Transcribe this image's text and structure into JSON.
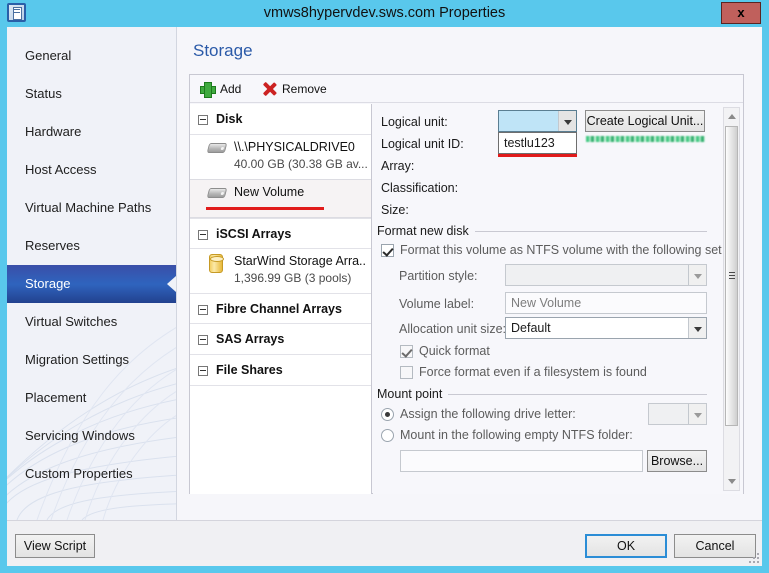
{
  "window": {
    "title": "vmws8hypervdev.sws.com Properties",
    "icon": "host-server-icon",
    "close_label": "x"
  },
  "sidebar": {
    "items": [
      {
        "label": "General",
        "selected": false
      },
      {
        "label": "Status",
        "selected": false
      },
      {
        "label": "Hardware",
        "selected": false
      },
      {
        "label": "Host Access",
        "selected": false
      },
      {
        "label": "Virtual Machine Paths",
        "selected": false
      },
      {
        "label": "Reserves",
        "selected": false
      },
      {
        "label": "Storage",
        "selected": true
      },
      {
        "label": "Virtual Switches",
        "selected": false
      },
      {
        "label": "Migration Settings",
        "selected": false
      },
      {
        "label": "Placement",
        "selected": false
      },
      {
        "label": "Servicing Windows",
        "selected": false
      },
      {
        "label": "Custom Properties",
        "selected": false
      }
    ]
  },
  "content": {
    "page_title": "Storage",
    "toolbar": {
      "add_label": "Add",
      "remove_label": "Remove"
    },
    "tree": {
      "groups": [
        {
          "label": "Disk"
        },
        {
          "label": "iSCSI Arrays"
        },
        {
          "label": "Fibre Channel Arrays"
        },
        {
          "label": "SAS Arrays"
        },
        {
          "label": "File Shares"
        }
      ],
      "disk_items": [
        {
          "label": "\\\\.\\PHYSICALDRIVE0",
          "sub": "40.00 GB (30.38 GB av...",
          "icon": "disk-icon",
          "selected": false
        },
        {
          "label": "New Volume",
          "sub": "",
          "icon": "disk-icon",
          "selected": true,
          "annotated": true
        }
      ],
      "iscsi_items": [
        {
          "label": "StarWind Storage Arra...",
          "sub": "1,396.99 GB (3 pools)",
          "icon": "storage-array-icon",
          "selected": false
        }
      ]
    },
    "details": {
      "logical_unit_label": "Logical unit:",
      "logical_unit_value": "",
      "logical_unit_options": [
        "testlu123"
      ],
      "logical_unit_dropdown_open": true,
      "create_logical_unit_label": "Create Logical Unit...",
      "redacted_note": "",
      "logical_unit_id_label": "Logical unit ID:",
      "logical_unit_id_value": "",
      "array_label": "Array:",
      "array_value": "",
      "classification_label": "Classification:",
      "classification_value": "",
      "size_label": "Size:",
      "size_value": "",
      "format_group_label": "Format new disk",
      "format_checkbox_label": "Format this volume as NTFS volume with the following set",
      "format_checkbox_checked": true,
      "partition_style_label": "Partition style:",
      "partition_style_value": "",
      "volume_label_label": "Volume label:",
      "volume_label_value": "New Volume",
      "allocation_unit_label": "Allocation unit size:",
      "allocation_unit_value": "Default",
      "quick_format_label": "Quick format",
      "quick_format_checked": true,
      "force_format_label": "Force format even if a filesystem is found",
      "force_format_checked": false,
      "mount_group_label": "Mount point",
      "assign_drive_letter_label": "Assign the following drive letter:",
      "assign_drive_letter_selected": true,
      "drive_letter_value": "",
      "mount_folder_label": "Mount in the following empty NTFS folder:",
      "mount_folder_selected": false,
      "mount_folder_value": "",
      "browse_label": "Browse..."
    }
  },
  "footer": {
    "view_script_label": "View Script",
    "ok_label": "OK",
    "cancel_label": "Cancel"
  },
  "colors": {
    "titlebar": "#59c8ec",
    "accent_blue": "#2b5aa8",
    "selected_nav": "#2f63bd",
    "annotation_red": "#e11b1b",
    "close_red": "#c0605c"
  }
}
